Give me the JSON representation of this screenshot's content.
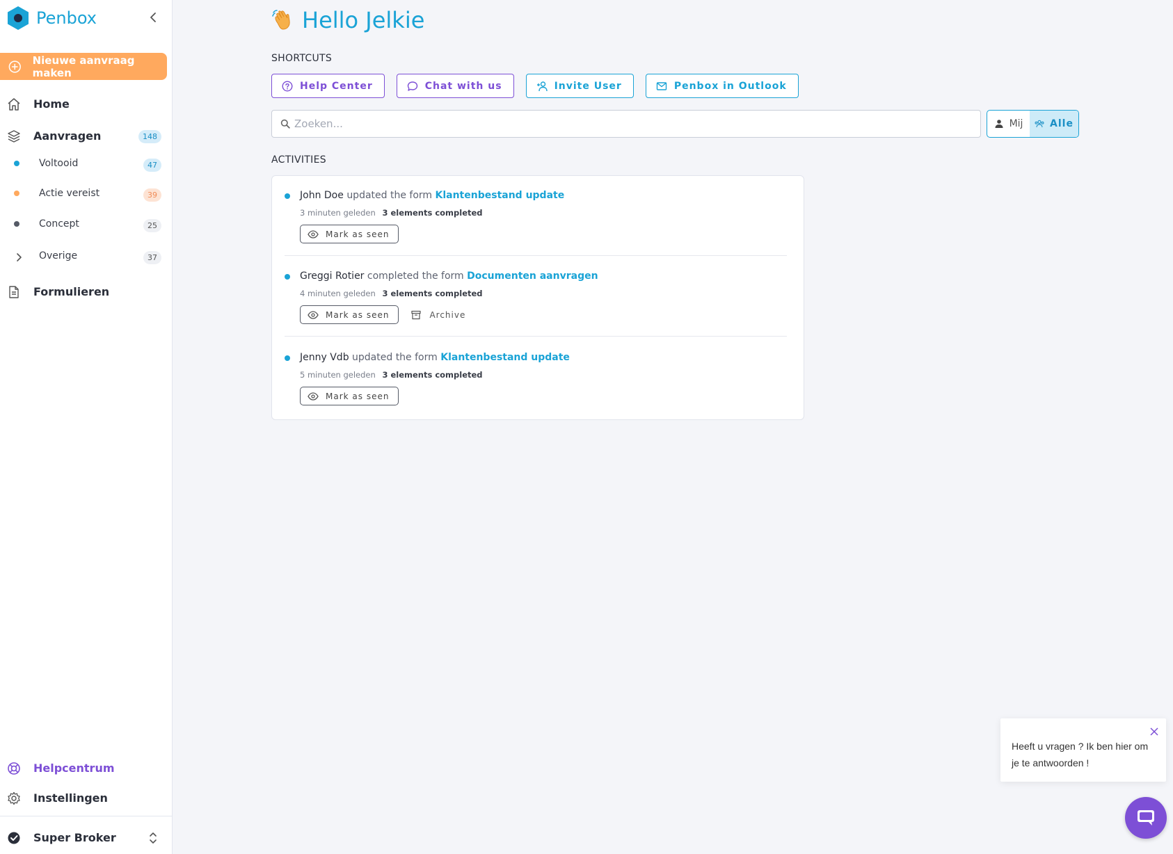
{
  "brand": {
    "name": "Penbox",
    "color": "#1aa3d6"
  },
  "sidebar": {
    "new_request_label": "Nieuwe aanvraag maken",
    "items": [
      {
        "label": "Home",
        "icon": "home-icon"
      },
      {
        "label": "Aanvragen",
        "icon": "layers-icon",
        "count": "148"
      },
      {
        "label": "Voltooid",
        "count": "47",
        "dot_color": "#1aa3d6"
      },
      {
        "label": "Actie vereist",
        "count": "39",
        "dot_color": "#ffa95e"
      },
      {
        "label": "Concept",
        "count": "25",
        "dot_color": "#555a66"
      },
      {
        "label": "Overige",
        "count": "37",
        "icon": "chevron-right-icon"
      },
      {
        "label": "Formulieren",
        "icon": "document-icon"
      }
    ],
    "help_label": "Helpcentrum",
    "settings_label": "Instellingen",
    "account_label": "Super Broker"
  },
  "main": {
    "greeting": "Hello Jelkie",
    "shortcuts_title": "SHORTCUTS",
    "shortcuts": [
      {
        "label": "Help Center",
        "icon": "question-circle-icon"
      },
      {
        "label": "Chat with us",
        "icon": "chat-icon"
      },
      {
        "label": "Invite User",
        "icon": "add-user-icon"
      },
      {
        "label": "Penbox in Outlook",
        "icon": "mail-icon"
      }
    ],
    "search": {
      "placeholder": "Zoeken..."
    },
    "filter": {
      "mine": "Mij",
      "all": "Alle",
      "selected": "Alle"
    },
    "activities_title": "ACTIVITIES",
    "activities": [
      {
        "actor": "John Doe",
        "verb": "updated the form",
        "form": "Klantenbestand update",
        "time": "3 minuten geleden",
        "completed": "3 elements completed",
        "mark_label": "Mark as seen"
      },
      {
        "actor": "Greggi Rotier",
        "verb": "completed the form",
        "form": "Documenten aanvragen",
        "time": "4 minuten geleden",
        "completed": "3 elements completed",
        "mark_label": "Mark as seen",
        "archive_label": "Archive"
      },
      {
        "actor": "Jenny Vdb",
        "verb": "updated the form",
        "form": "Klantenbestand update",
        "time": "5 minuten geleden",
        "completed": "3 elements completed",
        "mark_label": "Mark as seen"
      }
    ]
  },
  "chat": {
    "message": "Heeft u vragen ? Ik ben hier om je te antwoorden !",
    "accent": "#7d4fd6"
  }
}
